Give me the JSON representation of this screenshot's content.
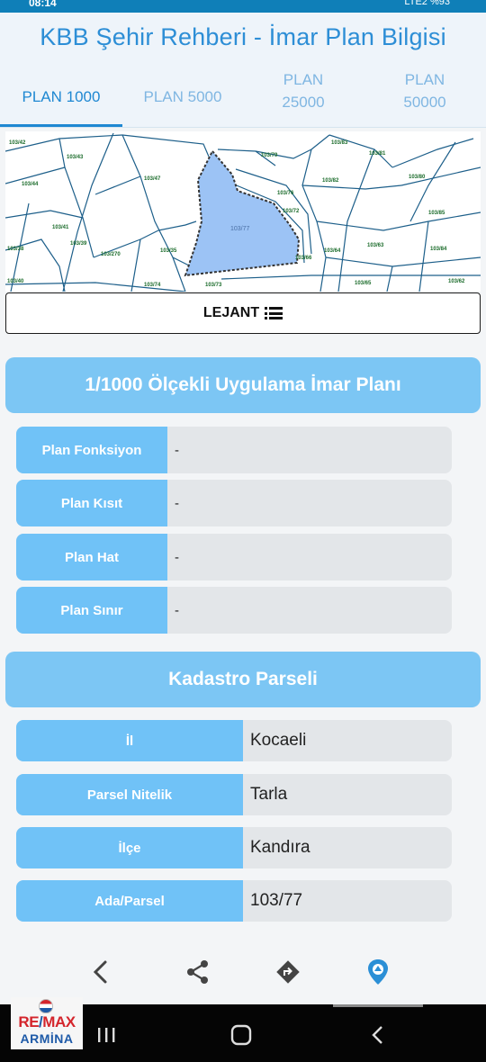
{
  "status_bar": {
    "time": "08:14",
    "network": "LTE2",
    "battery": "%93"
  },
  "app": {
    "title": "KBB Şehir Rehberi - İmar Plan Bilgisi"
  },
  "tabs": [
    {
      "label": "PLAN 1000",
      "active": true
    },
    {
      "label": "PLAN 5000",
      "active": false
    },
    {
      "label": "PLAN 25000",
      "active": false
    },
    {
      "label": "PLAN 50000",
      "active": false
    }
  ],
  "map": {
    "selected_parcel": "103/77",
    "parcel_fill": "#9cc3f5",
    "parcel_labels": [
      "103/42",
      "103/43",
      "103/44",
      "103/47",
      "103/41",
      "103/40",
      "103/39",
      "103/38",
      "103/270",
      "103/35",
      "103/74",
      "103/73",
      "103/72",
      "103/76",
      "103/79",
      "103/83",
      "103/82",
      "103/81",
      "103/80",
      "103/85",
      "103/84",
      "103/62",
      "103/63",
      "103/64",
      "103/65",
      "103/66",
      "103/67",
      "103/68"
    ]
  },
  "legend": {
    "label": "LEJANT"
  },
  "plan_section": {
    "title": "1/1000 Ölçekli Uygulama İmar Planı",
    "rows": [
      {
        "label": "Plan Fonksiyon",
        "value": "-"
      },
      {
        "label": "Plan Kısıt",
        "value": "-"
      },
      {
        "label": "Plan Hat",
        "value": "-"
      },
      {
        "label": "Plan Sınır",
        "value": "-"
      }
    ]
  },
  "kadastro_section": {
    "title": "Kadastro Parseli",
    "rows": [
      {
        "label": "İl",
        "value": "Kocaeli"
      },
      {
        "label": "Parsel Nitelik",
        "value": "Tarla"
      },
      {
        "label": "İlçe",
        "value": "Kandıra"
      },
      {
        "label": "Ada/Parsel",
        "value": "103/77"
      }
    ]
  },
  "bottom_nav": [
    "back-icon",
    "share-icon",
    "directions-icon",
    "location-icon"
  ],
  "watermark_logo": {
    "brand_left": "RE",
    "brand_right": "MAX",
    "office": "ARMİNA"
  },
  "colors": {
    "accent": "#1f88d2",
    "section_header": "#7cc6f4",
    "label_bg": "#70c2f7",
    "value_bg": "#e3e6e9",
    "map_line": "#1d5f8a"
  }
}
